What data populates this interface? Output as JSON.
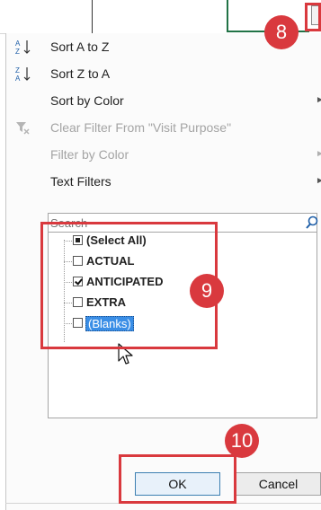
{
  "annotations": {
    "badge_8": "8",
    "badge_9": "9",
    "badge_10": "10",
    "color": "#d9393e"
  },
  "menu": {
    "sort_a_to_z": "Sort A to Z",
    "sort_z_to_a": "Sort Z to A",
    "sort_by_color": "Sort by Color",
    "clear_filter": "Clear Filter From \"Visit Purpose\"",
    "filter_by_color": "Filter by Color",
    "text_filters": "Text Filters",
    "submenu_arrow": "►"
  },
  "search": {
    "placeholder": "Search",
    "value": ""
  },
  "checklist": [
    {
      "label": "(Select All)",
      "state": "partial"
    },
    {
      "label": "ACTUAL",
      "state": "unchecked"
    },
    {
      "label": "ANTICIPATED",
      "state": "checked"
    },
    {
      "label": "EXTRA",
      "state": "unchecked"
    },
    {
      "label": "(Blanks)",
      "state": "unchecked"
    }
  ],
  "buttons": {
    "ok": "OK",
    "cancel": "Cancel"
  },
  "icons": {
    "sort_asc": "sort-ascending-icon",
    "sort_desc": "sort-descending-icon",
    "clear_filter": "clear-filter-icon",
    "search": "search-icon",
    "cursor": "mouse-pointer-icon"
  }
}
